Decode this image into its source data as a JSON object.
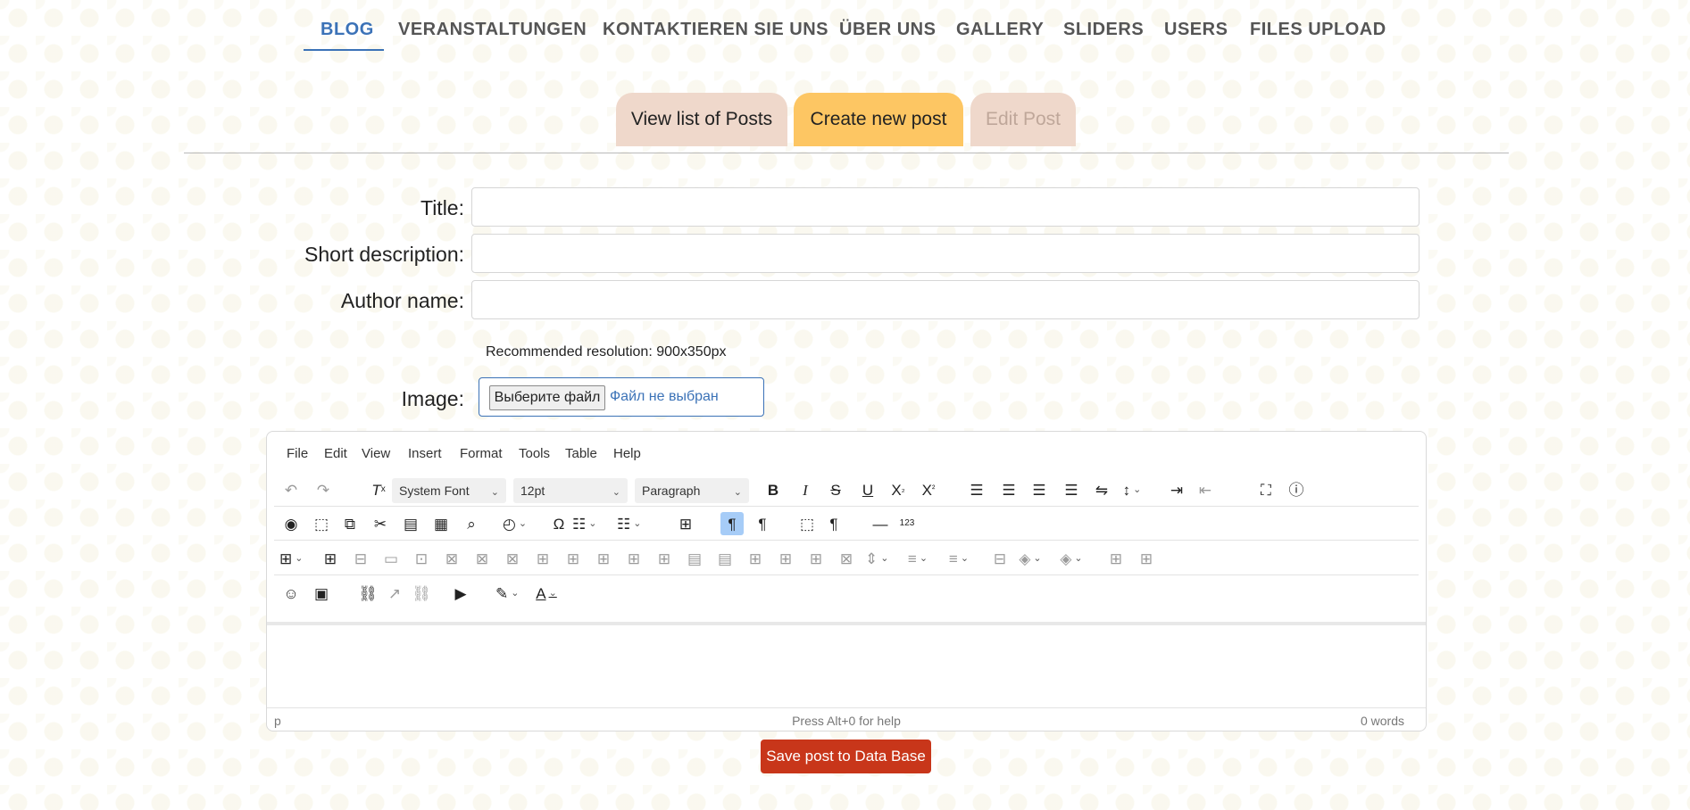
{
  "nav": {
    "items": [
      "BLOG",
      "VERANSTALTUNGEN",
      "KONTAKTIEREN SIE UNS",
      "ÜBER UNS",
      "GALLERY",
      "SLIDERS",
      "USERS",
      "FILES UPLOAD"
    ],
    "active": "BLOG"
  },
  "subtabs": {
    "view": "View list of Posts",
    "create": "Create new post",
    "edit": "Edit Post"
  },
  "form": {
    "title_label": "Title:",
    "title_value": "",
    "short_label": "Short description:",
    "short_value": "",
    "author_label": "Author name:",
    "author_value": "",
    "hint": "Recommended resolution: 900x350px",
    "image_label": "Image:",
    "file_button": "Выберите файл",
    "file_status": "Файл не выбран"
  },
  "editor": {
    "menu": [
      "File",
      "Edit",
      "View",
      "Insert",
      "Format",
      "Tools",
      "Table",
      "Help"
    ],
    "font_family": "System Font",
    "font_size": "12pt",
    "block_format": "Paragraph",
    "status_path": "p",
    "status_help": "Press Alt+0 for help",
    "word_count": "0 words"
  },
  "save_button": "Save post to Data Base",
  "colors": {
    "accent": "#3b72b7",
    "tab_inactive": "#efd8cb",
    "tab_active": "#fdc663",
    "save": "#c8361a"
  }
}
